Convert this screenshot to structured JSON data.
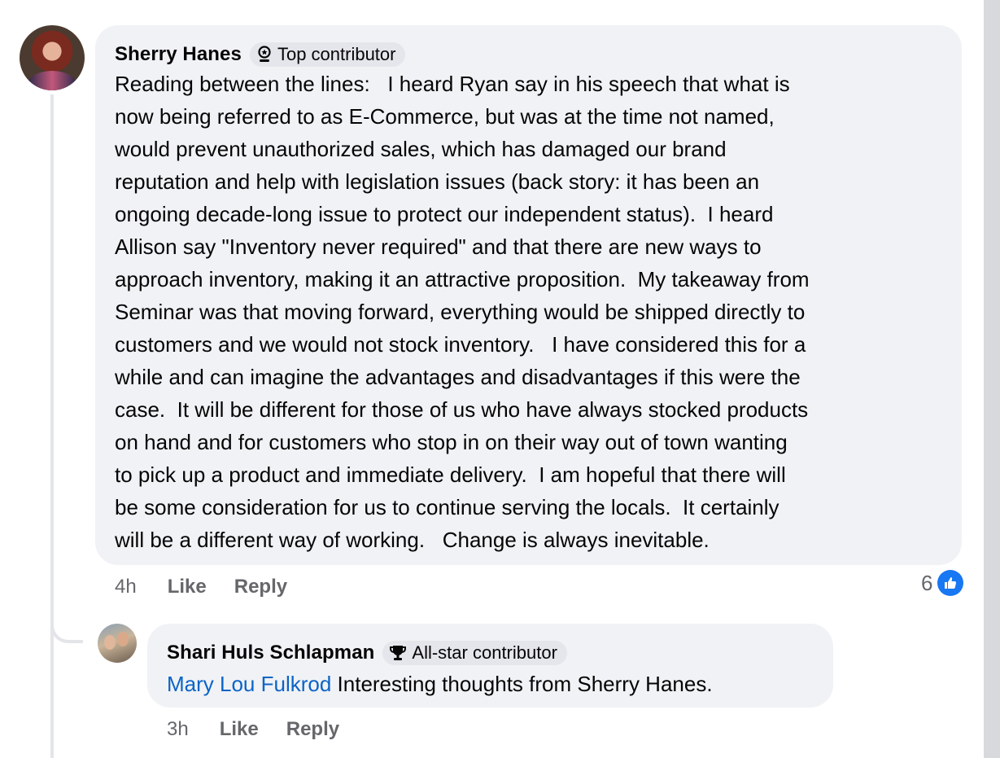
{
  "comment": {
    "author": "Sherry Hanes",
    "badge": "Top contributor",
    "badge_icon": "top-contributor-icon",
    "text": "Reading between the lines:   I heard Ryan say in his speech that what is\nnow being referred to as E-Commerce, but was at the time not named,\nwould prevent unauthorized sales, which has damaged our brand\nreputation and help with legislation issues (back story: it has been an\nongoing decade-long issue to protect our independent status).  I heard\nAllison say \"Inventory never required\" and that there are new ways to\napproach inventory, making it an attractive proposition.  My takeaway from\nSeminar was that moving forward, everything would be shipped directly to\ncustomers and we would not stock inventory.   I have considered this for a\nwhile and can imagine the advantages and disadvantages if this were the\ncase.  It will be different for those of us who have always stocked products\non hand and for customers who stop in on their way out of town wanting\nto pick up a product and immediate delivery.  I am hopeful that there will\nbe some consideration for us to continue serving the locals.  It certainly\nwill be a different way of working.   Change is always inevitable.",
    "time": "4h",
    "like_label": "Like",
    "reply_label": "Reply",
    "reaction_count": "6",
    "reaction_icon": "like-reaction-icon",
    "accent_color": "#1877f2"
  },
  "reply": {
    "author": "Shari Huls Schlapman",
    "badge": "All-star contributor",
    "badge_icon": "trophy-icon",
    "mention": "Mary Lou Fulkrod",
    "text": " Interesting thoughts from Sherry Hanes.",
    "time": "3h",
    "like_label": "Like",
    "reply_label": "Reply",
    "mention_color": "#0b63c7"
  }
}
